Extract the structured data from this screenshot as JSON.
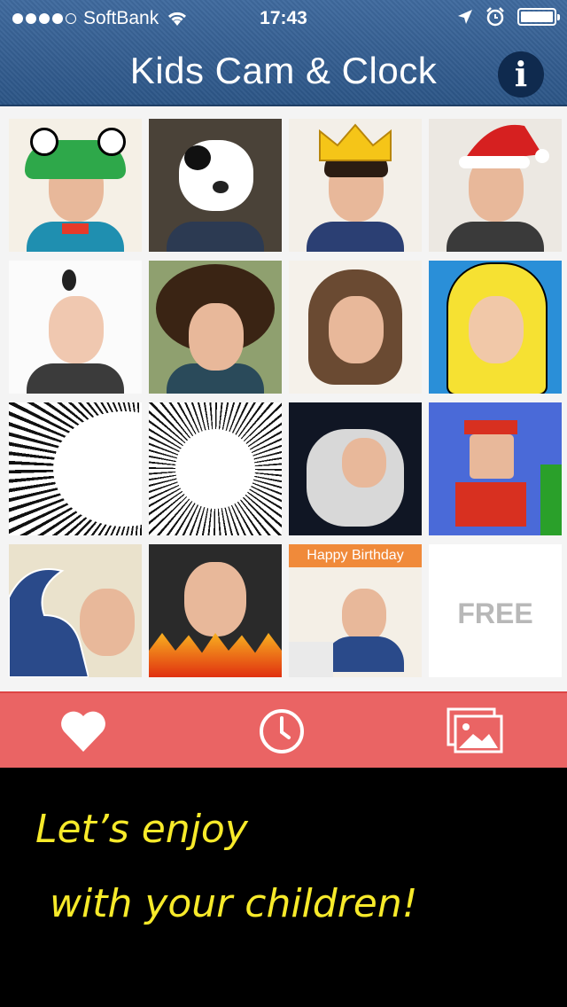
{
  "status": {
    "carrier": "SoftBank",
    "time": "17:43"
  },
  "header": {
    "title": "Kids Cam & Clock",
    "info_label": "i"
  },
  "grid": {
    "free_label": "FREE",
    "banner_text": "Happy Birthday"
  },
  "footer": {
    "line1": "Let’s enjoy",
    "line2": "with your children!"
  },
  "colors": {
    "nav": "#3f6a9e",
    "toolbar": "#ea6464",
    "slogan": "#f7ea2a"
  }
}
